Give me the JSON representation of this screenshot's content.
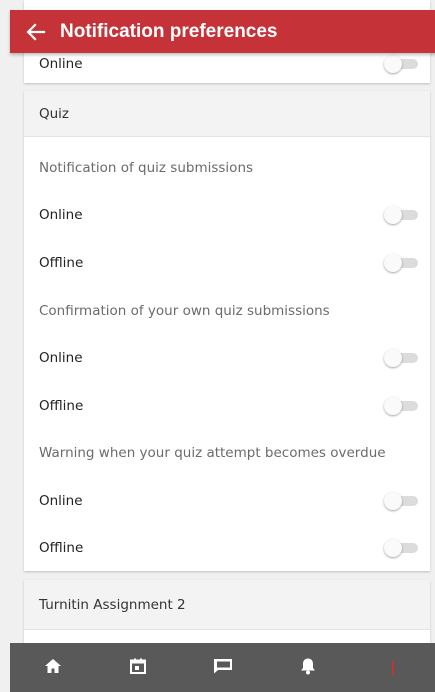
{
  "header": {
    "title": "Notification preferences",
    "back_icon": "back-arrow-icon",
    "color": "#c53339"
  },
  "sections": {
    "previous": {
      "item_label": "Online",
      "enabled": false
    },
    "quiz": {
      "title": "Quiz",
      "groups": [
        {
          "label": "Notification of quiz submissions",
          "online_label": "Online",
          "online_enabled": false,
          "offline_label": "Offline",
          "offline_enabled": false
        },
        {
          "label": "Confirmation of your own quiz submissions",
          "online_label": "Online",
          "online_enabled": false,
          "offline_label": "Offline",
          "offline_enabled": false
        },
        {
          "label": "Warning when your quiz attempt becomes overdue",
          "online_label": "Online",
          "online_enabled": false,
          "offline_label": "Offline",
          "offline_enabled": false
        }
      ]
    },
    "turnitin": {
      "title": "Turnitin Assignment 2"
    }
  },
  "tabbar": {
    "items": [
      {
        "icon": "home-icon"
      },
      {
        "icon": "calendar-icon"
      },
      {
        "icon": "messages-icon"
      },
      {
        "icon": "bell-icon"
      },
      {
        "icon": "more-icon"
      }
    ],
    "background": "#595959"
  }
}
